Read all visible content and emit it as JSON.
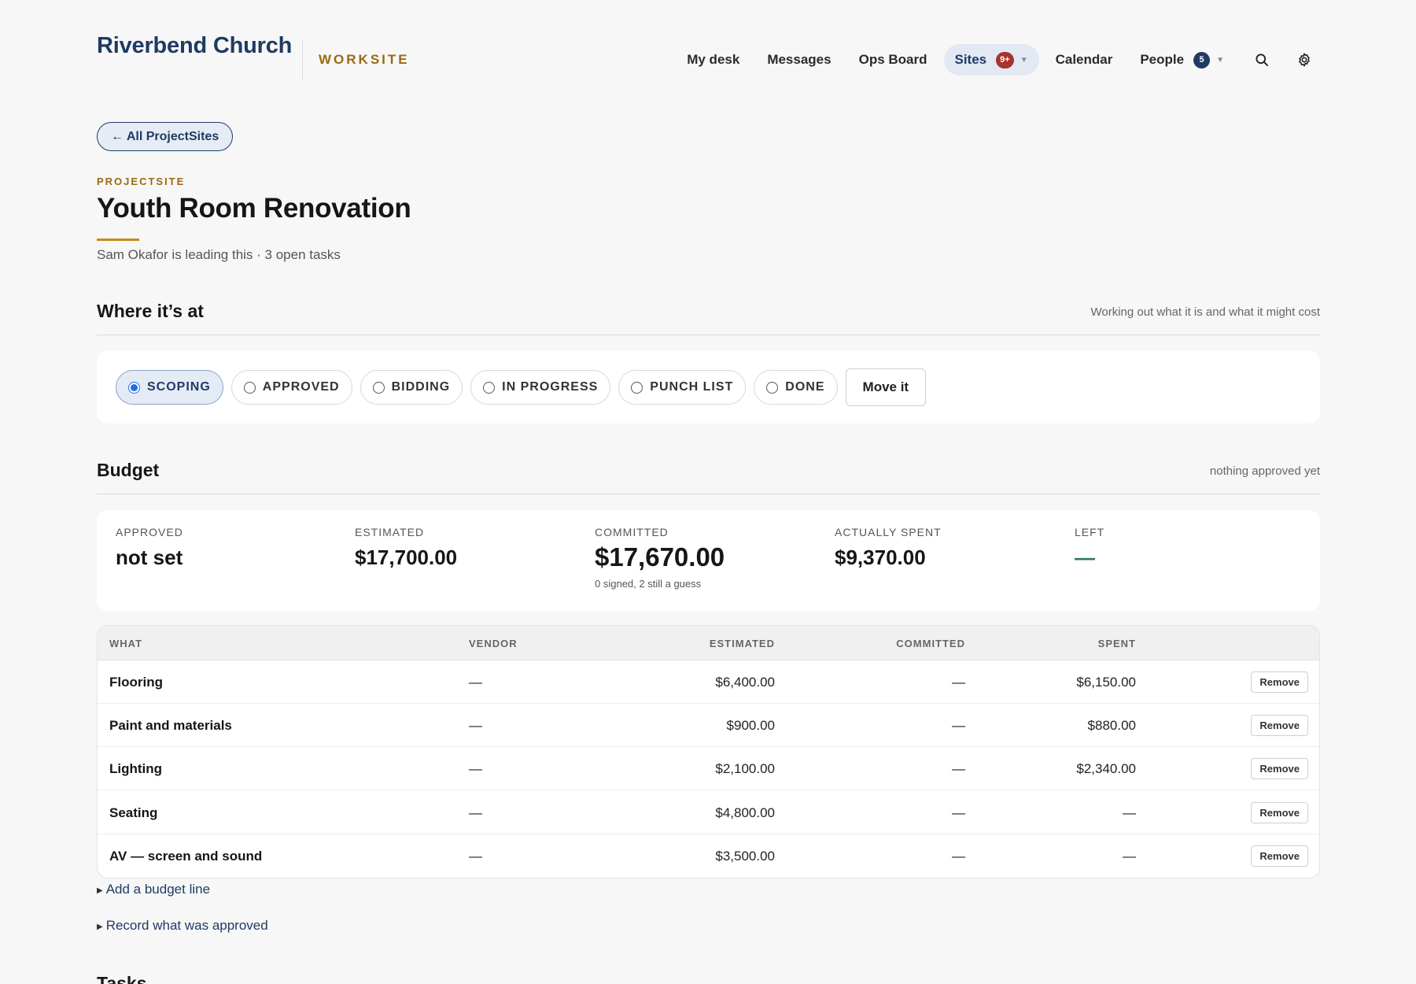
{
  "header": {
    "brand": "Riverbend Church",
    "brand_sub": "WORKSITE",
    "nav": [
      {
        "label": "My desk"
      },
      {
        "label": "Messages"
      },
      {
        "label": "Ops Board"
      },
      {
        "label": "Sites",
        "badge": "9+",
        "active": true
      },
      {
        "label": "Calendar"
      },
      {
        "label": "People",
        "badge": "5"
      }
    ],
    "icons": [
      "search-icon",
      "gear-icon"
    ]
  },
  "back_label": "← All ProjectSites",
  "project": {
    "eyebrow": "PROJECTSITE",
    "title": "Youth Room Renovation",
    "subtitle": "Sam Okafor is leading this · 3 open tasks"
  },
  "status_section": {
    "title": "Where it’s at",
    "note": "Working out what it is and what it might cost",
    "stages": [
      "SCOPING",
      "APPROVED",
      "BIDDING",
      "IN PROGRESS",
      "PUNCH LIST",
      "DONE"
    ],
    "selected_stage": "SCOPING",
    "move_label": "Move it"
  },
  "budget": {
    "title": "Budget",
    "note": "nothing approved yet",
    "metrics": {
      "approved": {
        "label": "APPROVED",
        "value": "not set"
      },
      "estimated": {
        "label": "ESTIMATED",
        "value": "$17,700.00"
      },
      "committed": {
        "label": "COMMITTED",
        "value": "$17,670.00",
        "hint": "0 signed, 2 still a guess"
      },
      "spent": {
        "label": "ACTUALLY SPENT",
        "value": "$9,370.00"
      },
      "left": {
        "label": "LEFT",
        "value": "—"
      }
    },
    "columns": [
      "WHAT",
      "VENDOR",
      "ESTIMATED",
      "COMMITTED",
      "SPENT"
    ],
    "remove_label": "Remove",
    "rows": [
      {
        "what": "Flooring",
        "vendor": "—",
        "estimated": "$6,400.00",
        "committed": "—",
        "spent": "$6,150.00"
      },
      {
        "what": "Paint and materials",
        "vendor": "—",
        "estimated": "$900.00",
        "committed": "—",
        "spent": "$880.00"
      },
      {
        "what": "Lighting",
        "vendor": "—",
        "estimated": "$2,100.00",
        "committed": "—",
        "spent": "$2,340.00"
      },
      {
        "what": "Seating",
        "vendor": "—",
        "estimated": "$4,800.00",
        "committed": "—",
        "spent": "—"
      },
      {
        "what": "AV — screen and sound",
        "vendor": "—",
        "estimated": "$3,500.00",
        "committed": "—",
        "spent": "—"
      }
    ],
    "add_line_label": "Add a budget line",
    "record_approved_label": "Record what was approved"
  },
  "tasks_section": {
    "title": "Tasks"
  },
  "colors": {
    "brand_navy": "#1f3b63",
    "accent_gold": "#9a6a12",
    "badge_red": "#a8322d",
    "radio_blue": "#1f6fe0"
  }
}
